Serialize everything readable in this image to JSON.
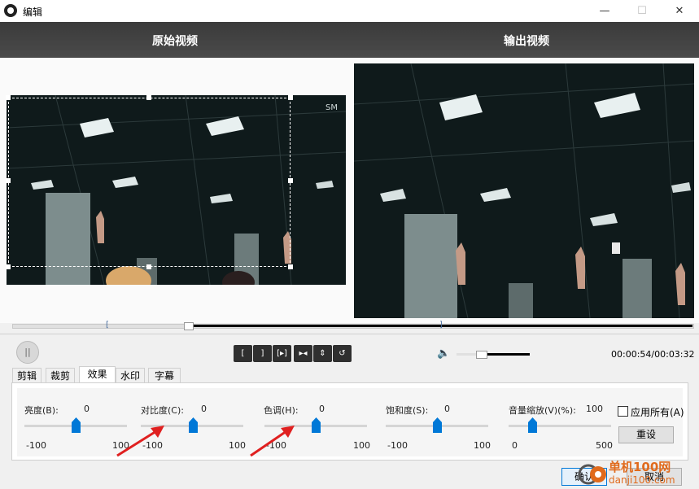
{
  "window": {
    "title": "编辑",
    "minimize": "—",
    "maximize": "☐",
    "close": "✕"
  },
  "header": {
    "original_label": "原始视频",
    "output_label": "输出视频"
  },
  "player": {
    "time": "00:00:54/00:03:32",
    "pause_glyph": "||",
    "controls": [
      "[",
      "]",
      "[▸]",
      "▸◂",
      "⇕",
      "↺"
    ],
    "volume_glyph": "🔈"
  },
  "tabs": [
    {
      "label": "剪辑"
    },
    {
      "label": "裁剪"
    },
    {
      "label": "效果"
    },
    {
      "label": "水印"
    },
    {
      "label": "字幕"
    }
  ],
  "sliders": [
    {
      "label": "亮度(B):",
      "value": "0",
      "min": "-100",
      "max": "100"
    },
    {
      "label": "对比度(C):",
      "value": "0",
      "min": "-100",
      "max": "100"
    },
    {
      "label": "色调(H):",
      "value": "0",
      "min": "-100",
      "max": "100"
    },
    {
      "label": "饱和度(S):",
      "value": "0",
      "min": "-100",
      "max": "100"
    },
    {
      "label": "音量缩放(V)(%):",
      "value": "100",
      "min": "0",
      "max": "500"
    }
  ],
  "apply_all_label": "应用所有(A)",
  "reset_label": "重设",
  "ok_label": "确认",
  "cancel_label": "取消",
  "watermark": {
    "line1": "单机100网",
    "line2": "danji100.com"
  },
  "colors": {
    "accent": "#0078d7",
    "header_bg": "#3b3b3b",
    "annotation_arrow": "#e02020"
  }
}
